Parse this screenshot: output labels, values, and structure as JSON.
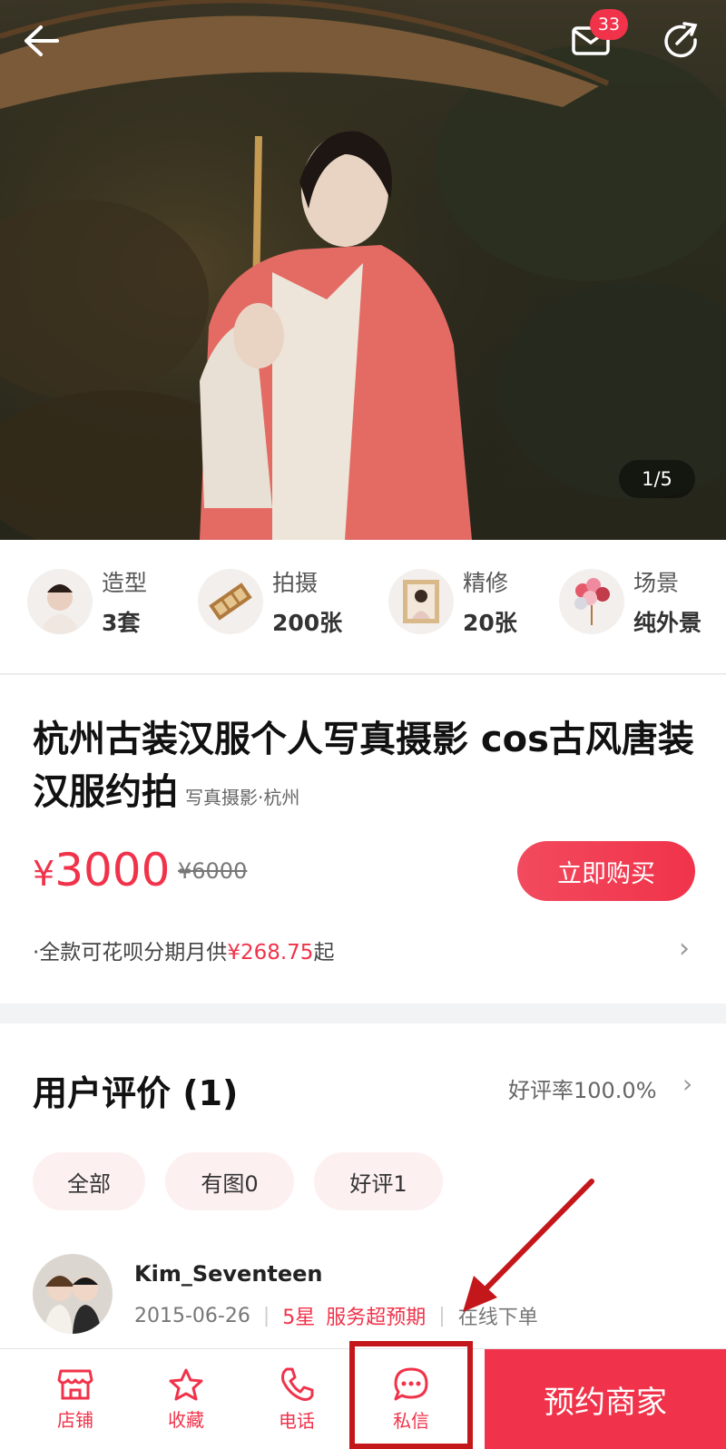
{
  "header": {
    "mail_badge": "33",
    "image_counter": "1/5",
    "icons": [
      "back-arrow-icon",
      "mail-icon",
      "share-icon"
    ]
  },
  "features": [
    {
      "label": "造型",
      "value": "3套"
    },
    {
      "label": "拍摄",
      "value": "200张"
    },
    {
      "label": "精修",
      "value": "20张"
    },
    {
      "label": "场景",
      "value": "纯外景"
    }
  ],
  "product": {
    "title": "杭州古装汉服个人写真摄影 cos古风唐装汉服约拍",
    "subtitle": "写真摄影·杭州",
    "currency": "¥",
    "price": "3000",
    "old_price": "¥6000",
    "buy_label": "立即购买",
    "installment_prefix": "·全款可花呗分期月供",
    "installment_amount": "¥268.75",
    "installment_suffix": "起"
  },
  "reviews": {
    "title": "用户评价 (1)",
    "good_rate": "好评率100.0%",
    "filters": [
      "全部",
      "有图0",
      "好评1"
    ],
    "items": [
      {
        "user": "Kim_Seventeen",
        "date": "2015-06-26",
        "rating": "5星",
        "comment": "服务超预期",
        "source": "在线下单"
      }
    ]
  },
  "bottom_bar": {
    "tabs": [
      {
        "label": "店铺",
        "icon": "store-icon"
      },
      {
        "label": "收藏",
        "icon": "star-icon"
      },
      {
        "label": "电话",
        "icon": "phone-icon"
      },
      {
        "label": "私信",
        "icon": "chat-icon"
      }
    ],
    "reserve_label": "预约商家"
  },
  "colors": {
    "accent": "#f0334a",
    "annotation": "#c4171c"
  }
}
